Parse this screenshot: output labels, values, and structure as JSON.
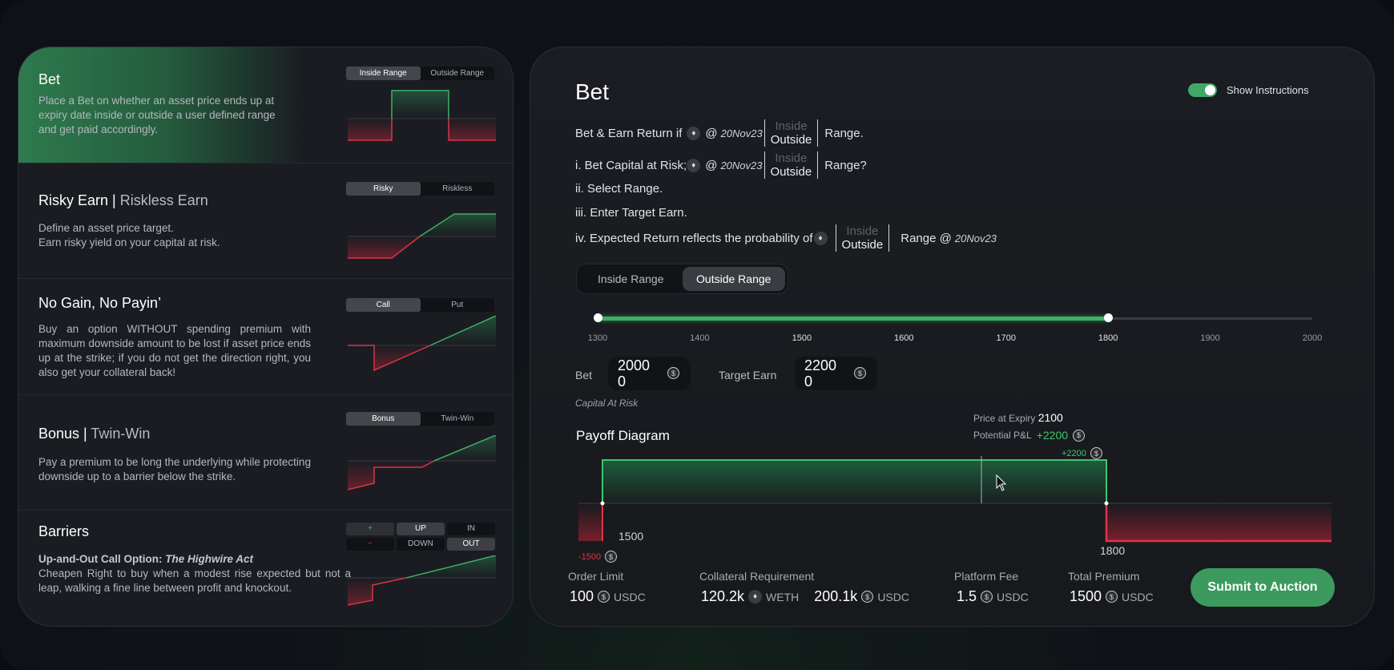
{
  "left_panel": {
    "sections": [
      {
        "title": "Bet",
        "title_dim": "",
        "description": "Place a Bet on whether an asset price ends up at expiry date inside or outside a user defined range and get paid accordingly.",
        "tabs": [
          "Inside Range",
          "Outside Range"
        ],
        "active_tab": 0
      },
      {
        "title": "Risky Earn |",
        "title_dim": " Riskless Earn",
        "description_lines": [
          "Define an asset price target.",
          "Earn risky yield on your capital at risk."
        ],
        "tabs": [
          "Risky",
          "Riskless"
        ],
        "active_tab": 0
      },
      {
        "title": "No Gain, No Payin’",
        "description": "Buy an option WITHOUT spending premium with maximum downside amount to be lost if asset price ends up at the strike; if you do not get the direction right, you also get your collateral back!",
        "tabs": [
          "Call",
          "Put"
        ],
        "active_tab": 0
      },
      {
        "title": "Bonus |",
        "title_dim": " Twin-Win",
        "description": "Pay a premium to be long the underlying while protecting downside up to a barrier below the strike.",
        "tabs": [
          "Bonus",
          "Twin-Win"
        ],
        "active_tab": 0
      },
      {
        "title": "Barriers",
        "subtitle": "Up-and-Out Call Option:",
        "subtitle_italic": "The Highwire Act",
        "description": "Cheapen Right to buy when a modest rise expected but not a leap, walking a fine line between profit and knockout.",
        "grid": [
          "+",
          "UP",
          "IN",
          "−",
          "DOWN",
          "OUT"
        ]
      }
    ]
  },
  "main": {
    "title": "Bet",
    "show_instructions_label": "Show Instructions",
    "show_instructions_on": true,
    "date": "20Nov23",
    "range_inside": "Inside",
    "range_outside": "Outside",
    "instructions": {
      "l0_a": "Bet & Earn Return if",
      "l0_b": "Range.",
      "l1_a": "i. Bet Capital at Risk;",
      "l1_b": "Range?",
      "l2": "ii. Select Range.",
      "l3": "iii. Enter Target Earn.",
      "l4_a": "iv. Expected Return reflects the probability of",
      "l4_b": "Range @"
    },
    "at": "@",
    "range_tabs": [
      "Inside Range",
      "Outside Range"
    ],
    "active_range_tab": 1,
    "slider": {
      "ticks": [
        "1300",
        "1400",
        "1500",
        "1600",
        "1700",
        "1800",
        "1900",
        "2000"
      ],
      "min": 1300,
      "max": 2000,
      "low": 1300,
      "high": 1800
    },
    "bet_label": "Bet",
    "bet_value": "20000",
    "target_label": "Target Earn",
    "target_value": "22000",
    "capital_at_risk": "Capital At Risk",
    "payoff": {
      "title": "Payoff Diagram",
      "price_at_expiry_label": "Price at Expiry",
      "price_at_expiry": "2100",
      "pnl_label": "Potential P&L",
      "pnl": "+2200",
      "max_gain": "+2200",
      "max_loss": "-1500",
      "lower_strike": "1500",
      "upper_strike": "1800"
    },
    "stats": {
      "order_limit_label": "Order Limit",
      "order_limit": "100",
      "order_limit_unit": "USDC",
      "collateral_label": "Collateral Requirement",
      "collateral_weth": "120.2k",
      "weth_unit": "WETH",
      "collateral_usdc": "200.1k",
      "collateral_usdc_unit": "USDC",
      "fee_label": "Platform Fee",
      "fee": "1.5",
      "fee_unit": "USDC",
      "premium_label": "Total Premium",
      "premium": "1500",
      "premium_unit": "USDC"
    },
    "submit_label": "Submit to Auction"
  },
  "colors": {
    "accent": "#3fae66",
    "loss": "#e0344a",
    "button": "#3c9a5f"
  }
}
